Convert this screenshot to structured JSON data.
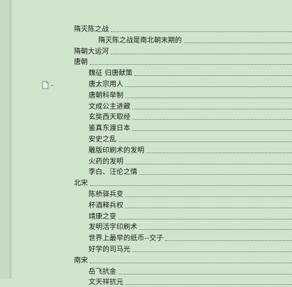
{
  "toc": [
    {
      "text": "隋灭陈之战",
      "level": 1
    },
    {
      "text": "隋灭陈之战是南北朝末期的",
      "level": 3
    },
    {
      "text": "隋朝大运河",
      "level": 1
    },
    {
      "text": "唐朝",
      "level": 1
    },
    {
      "text": "魏征 归唐献策",
      "level": 2
    },
    {
      "text": "唐太宗用人",
      "level": 2
    },
    {
      "text": "唐朝科举制",
      "level": 2
    },
    {
      "text": "文成公主进藏",
      "level": 2
    },
    {
      "text": "玄奘西天取经",
      "level": 2
    },
    {
      "text": "鉴真东渡日本",
      "level": 2
    },
    {
      "text": "安史之乱",
      "level": 2
    },
    {
      "text": "雕版印刷术的发明",
      "level": 2
    },
    {
      "text": "火药的发明",
      "level": 2
    },
    {
      "text": "李白、汪伦之情",
      "level": 2
    },
    {
      "text": "北宋",
      "level": 1
    },
    {
      "text": "陈桥驿兵变",
      "level": 2
    },
    {
      "text": "杯酒释兵权",
      "level": 2
    },
    {
      "text": "靖康之变",
      "level": 2
    },
    {
      "text": "发明活字印刷术",
      "level": 2
    },
    {
      "text": "世界上最早的纸币--交子",
      "level": 2
    },
    {
      "text": "好学的司马光",
      "level": 2
    },
    {
      "text": "南宋",
      "level": 1
    },
    {
      "text": "岳飞抗金",
      "level": 2
    },
    {
      "text": "文天祥抗元",
      "level": 2
    }
  ],
  "icons": {
    "margin": "document-icon"
  },
  "colors": {
    "background": "#cfe6cd",
    "text": "#1a1a1a"
  }
}
